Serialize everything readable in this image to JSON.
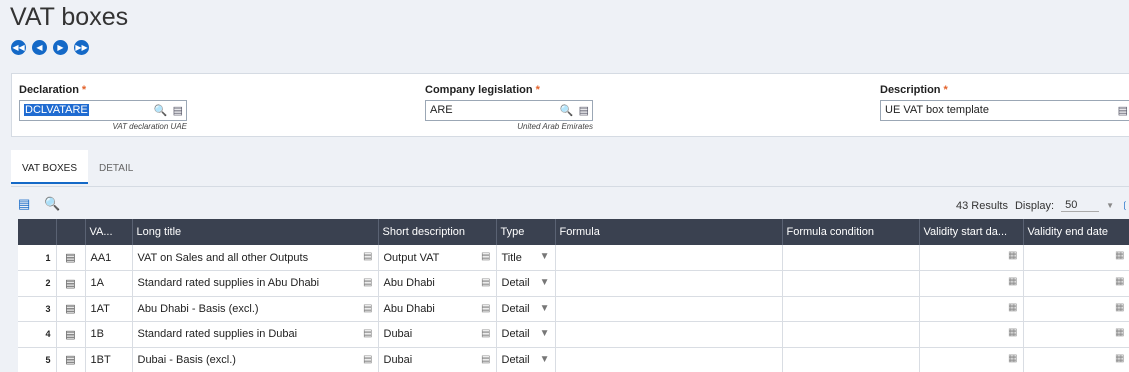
{
  "page": {
    "title": "VAT boxes"
  },
  "nav": {
    "first": "first-record",
    "prev": "previous-record",
    "next": "next-record",
    "last": "last-record"
  },
  "form": {
    "declaration": {
      "label": "Declaration",
      "value": "DCLVATARE",
      "sub": "VAT declaration UAE"
    },
    "legislation": {
      "label": "Company legislation",
      "value": "ARE",
      "sub": "United Arab Emirates"
    },
    "description": {
      "label": "Description",
      "value": "UE VAT box template"
    }
  },
  "tabs": {
    "vat_boxes": "VAT BOXES",
    "detail": "DETAIL"
  },
  "grid": {
    "results": "43 Results",
    "display_label": "Display:",
    "display_value": "50",
    "columns": [
      "VA...",
      "Long title",
      "Short description",
      "Type",
      "Formula",
      "Formula condition",
      "Validity start da...",
      "Validity end date"
    ],
    "rows": [
      {
        "n": "1",
        "code": "AA1",
        "long": "VAT on Sales and all other Outputs",
        "short": "Output VAT",
        "type": "Title"
      },
      {
        "n": "2",
        "code": "1A",
        "long": "Standard rated supplies in Abu Dhabi",
        "short": "Abu Dhabi",
        "type": "Detail"
      },
      {
        "n": "3",
        "code": "1AT",
        "long": "Abu Dhabi - Basis (excl.)",
        "short": "Abu Dhabi",
        "type": "Detail"
      },
      {
        "n": "4",
        "code": "1B",
        "long": "Standard rated supplies in Dubai",
        "short": "Dubai",
        "type": "Detail"
      },
      {
        "n": "5",
        "code": "1BT",
        "long": "Dubai - Basis (excl.)",
        "short": "Dubai",
        "type": "Detail"
      }
    ]
  }
}
